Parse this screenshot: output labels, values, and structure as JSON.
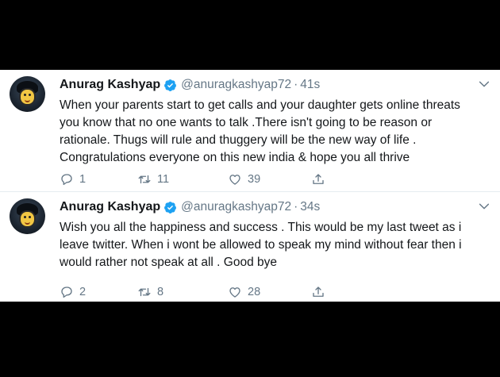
{
  "tweets": [
    {
      "author_name": "Anurag Kashyap",
      "handle": "@anuragkashyap72",
      "separator": "·",
      "time": "41s",
      "lines": [
        "When your parents start to get calls and your daughter gets online threats",
        "you know that no one wants to talk .There isn't going to be reason or",
        "rationale. Thugs will rule and thuggery will be the new way of life .",
        "Congratulations everyone on this new india & hope you all thrive"
      ],
      "replies": "1",
      "retweets": "11",
      "likes": "39"
    },
    {
      "author_name": "Anurag Kashyap",
      "handle": "@anuragkashyap72",
      "separator": "·",
      "time": "34s",
      "lines": [
        "Wish you all the happiness and success . This would be my last tweet as i",
        "leave twitter. When i wont be allowed to speak my mind without fear then i",
        "would rather not speak at all . Good bye"
      ],
      "replies": "2",
      "retweets": "8",
      "likes": "28"
    }
  ],
  "colors": {
    "background": "#000000",
    "card": "#ffffff",
    "verified": "#1da1f2",
    "muted": "#657786",
    "text": "#14171a"
  },
  "icons": [
    "verified-badge-icon",
    "chevron-down-icon",
    "reply-icon",
    "retweet-icon",
    "like-icon",
    "share-icon"
  ]
}
